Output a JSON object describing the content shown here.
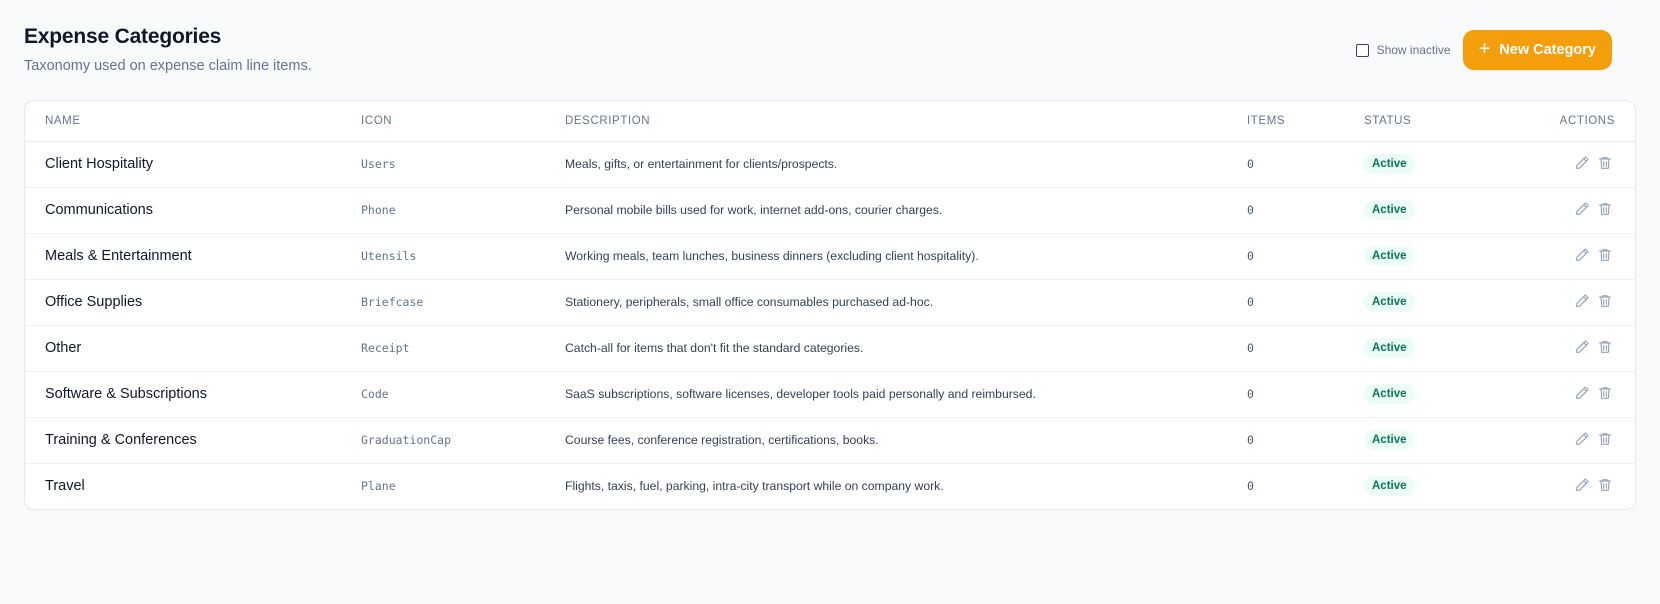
{
  "header": {
    "title": "Expense Categories",
    "subtitle": "Taxonomy used on expense claim line items."
  },
  "toolbar": {
    "show_inactive_label": "Show inactive",
    "show_inactive_checked": false,
    "new_category_label": "New Category"
  },
  "colors": {
    "accent": "#f59e0b",
    "status_active_bg": "#ecfdf5",
    "status_active_text": "#047857"
  },
  "table": {
    "columns": [
      "Name",
      "Icon",
      "Description",
      "Items",
      "Status",
      "Actions"
    ],
    "rows": [
      {
        "name": "Client Hospitality",
        "icon": "Users",
        "description": "Meals, gifts, or entertainment for clients/prospects.",
        "items": "0",
        "status": "Active"
      },
      {
        "name": "Communications",
        "icon": "Phone",
        "description": "Personal mobile bills used for work, internet add-ons, courier charges.",
        "items": "0",
        "status": "Active"
      },
      {
        "name": "Meals & Entertainment",
        "icon": "Utensils",
        "description": "Working meals, team lunches, business dinners (excluding client hospitality).",
        "items": "0",
        "status": "Active"
      },
      {
        "name": "Office Supplies",
        "icon": "Briefcase",
        "description": "Stationery, peripherals, small office consumables purchased ad-hoc.",
        "items": "0",
        "status": "Active"
      },
      {
        "name": "Other",
        "icon": "Receipt",
        "description": "Catch-all for items that don't fit the standard categories.",
        "items": "0",
        "status": "Active"
      },
      {
        "name": "Software & Subscriptions",
        "icon": "Code",
        "description": "SaaS subscriptions, software licenses, developer tools paid personally and reimbursed.",
        "items": "0",
        "status": "Active"
      },
      {
        "name": "Training & Conferences",
        "icon": "GraduationCap",
        "description": "Course fees, conference registration, certifications, books.",
        "items": "0",
        "status": "Active"
      },
      {
        "name": "Travel",
        "icon": "Plane",
        "description": "Flights, taxis, fuel, parking, intra-city transport while on company work.",
        "items": "0",
        "status": "Active"
      }
    ],
    "row_actions": [
      "pencil-icon",
      "trash-icon"
    ]
  }
}
